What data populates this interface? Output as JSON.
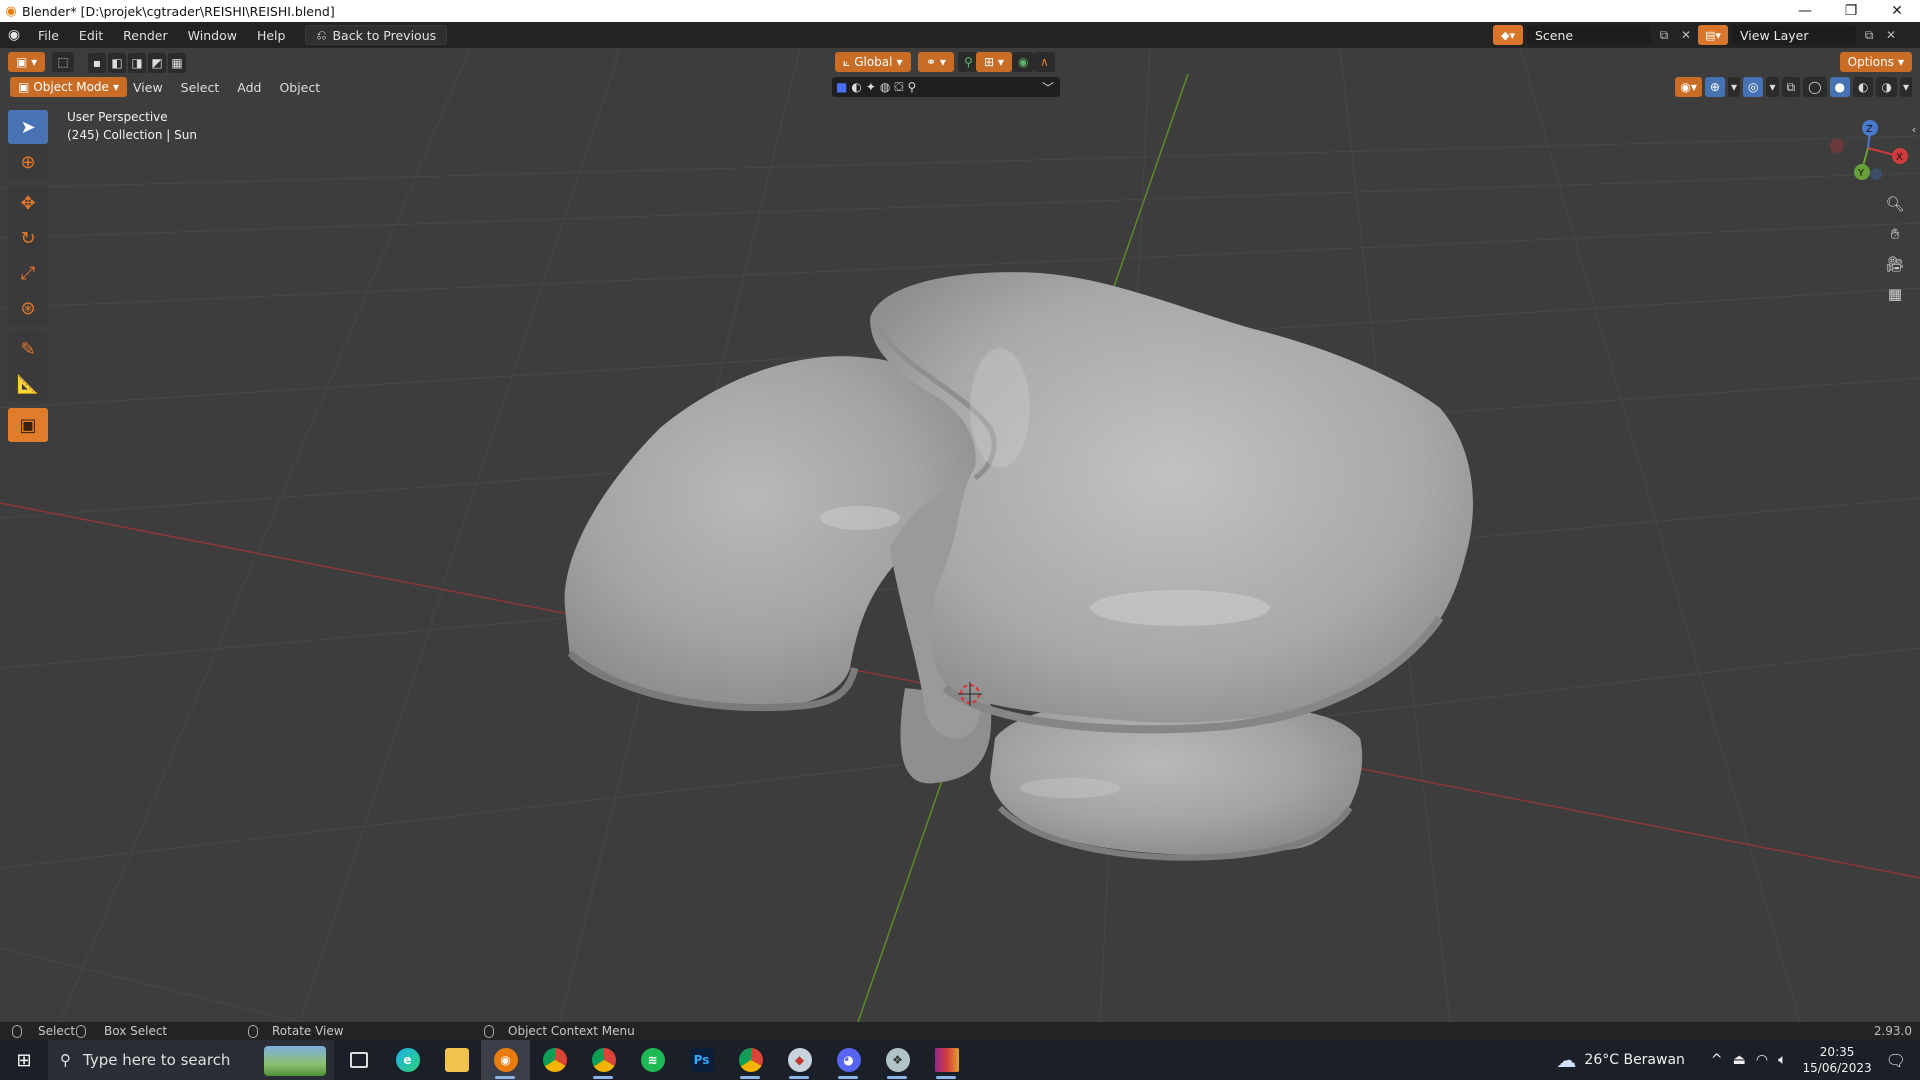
{
  "window": {
    "title": "Blender* [D:\\projek\\cgtrader\\REISHI\\REISHI.blend]",
    "controls": [
      "—",
      "❐",
      "✕"
    ]
  },
  "menubar": {
    "items": [
      "File",
      "Edit",
      "Render",
      "Window",
      "Help"
    ],
    "back_label": "Back to Previous",
    "scene_label": "Scene",
    "view_layer_label": "View Layer"
  },
  "viewport_header": {
    "transform_orientation": "Global",
    "options_label": "Options",
    "mode_label": "Object Mode",
    "menus": [
      "View",
      "Select",
      "Add",
      "Object"
    ]
  },
  "viewport": {
    "perspective_label": "User Perspective",
    "collection_label": "(245) Collection | Sun",
    "gizmo": {
      "x": "X",
      "y": "Y",
      "z": "Z"
    }
  },
  "statusbar": {
    "select": "Select",
    "box_select": "Box Select",
    "rotate_view": "Rotate View",
    "context_menu": "Object Context Menu",
    "version": "2.93.0"
  },
  "taskbar": {
    "search_placeholder": "Type here to search",
    "weather": "26°C  Berawan",
    "time": "20:35",
    "date": "15/06/2023",
    "apps": [
      "task-view",
      "edge",
      "explorer",
      "blender",
      "chrome",
      "chrome-profile",
      "spotify",
      "photoshop",
      "chrome-2",
      "app-a",
      "discord",
      "app-b",
      "winrar"
    ]
  },
  "colors": {
    "accent_orange": "#e07c2a",
    "active_tool_blue": "#4772b3",
    "viewport_bg": "#3d3d3d",
    "axis_x": "#a63a3a",
    "axis_y": "#5c8a2a"
  }
}
